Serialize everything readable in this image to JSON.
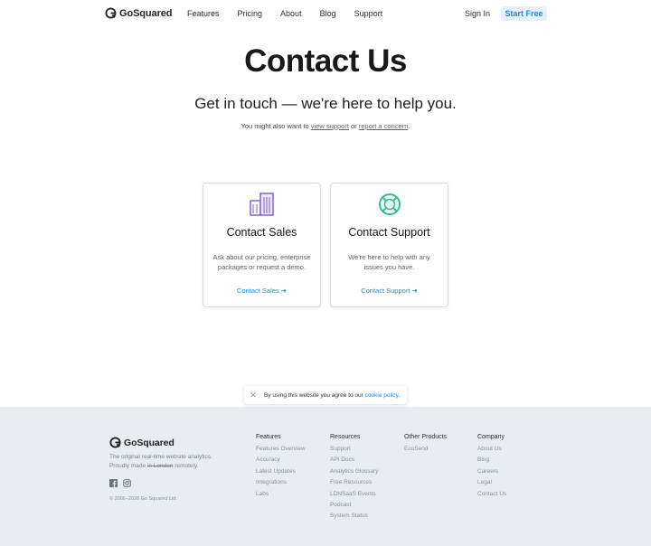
{
  "header": {
    "brand": "GoSquared",
    "nav": [
      "Features",
      "Pricing",
      "About",
      "Blog",
      "Support"
    ],
    "sign_in": "Sign In",
    "start_free": "Start Free"
  },
  "hero": {
    "title": "Contact Us",
    "subtitle": "Get in touch — we're here to help you.",
    "note_prefix": "You might also want to ",
    "note_link1": "view support",
    "note_mid": " or ",
    "note_link2": "report a concern",
    "note_suffix": "."
  },
  "cards": {
    "sales": {
      "title": "Contact Sales",
      "desc": "Ask about our pricing, enterprise packages or request a demo.",
      "link": "Contact Sales ➔",
      "icon": "buildings-icon"
    },
    "support": {
      "title": "Contact Support",
      "desc": "We're here to help with any issues you have.",
      "link": "Contact Support ➔",
      "icon": "lifebuoy-icon"
    }
  },
  "cookie": {
    "text": "By using this website you agree to our ",
    "link": "cookie policy",
    "suffix": "."
  },
  "footer": {
    "brand": "GoSquared",
    "tagline_1": "The original real-time website analytics.",
    "tagline_2a": "Proudly made ",
    "tagline_2b": "in London",
    "tagline_2c": " remotely.",
    "copyright": "© 2006–2026 Go Squared Ltd.",
    "columns": [
      {
        "title": "Features",
        "items": [
          "Features Overview",
          "Accuracy",
          "Latest Updates",
          "Integrations",
          "Labs"
        ]
      },
      {
        "title": "Resources",
        "items": [
          "Support",
          "API Docs",
          "Analytics Glossary",
          "Free Resources",
          "LDNSaaS Events",
          "Podcast",
          "System Status"
        ]
      },
      {
        "title": "Other Products",
        "items": [
          "EcoSend"
        ]
      },
      {
        "title": "Company",
        "items": [
          "About Us",
          "Blog",
          "Careers",
          "Legal",
          "Contact Us"
        ]
      }
    ]
  },
  "colors": {
    "accent": "#1e88d9",
    "accent_bg": "#e7f1fb",
    "sales_icon": "#7b5cc9",
    "support_icon": "#2fbf8f",
    "footer_bg": "#e9edf2"
  }
}
